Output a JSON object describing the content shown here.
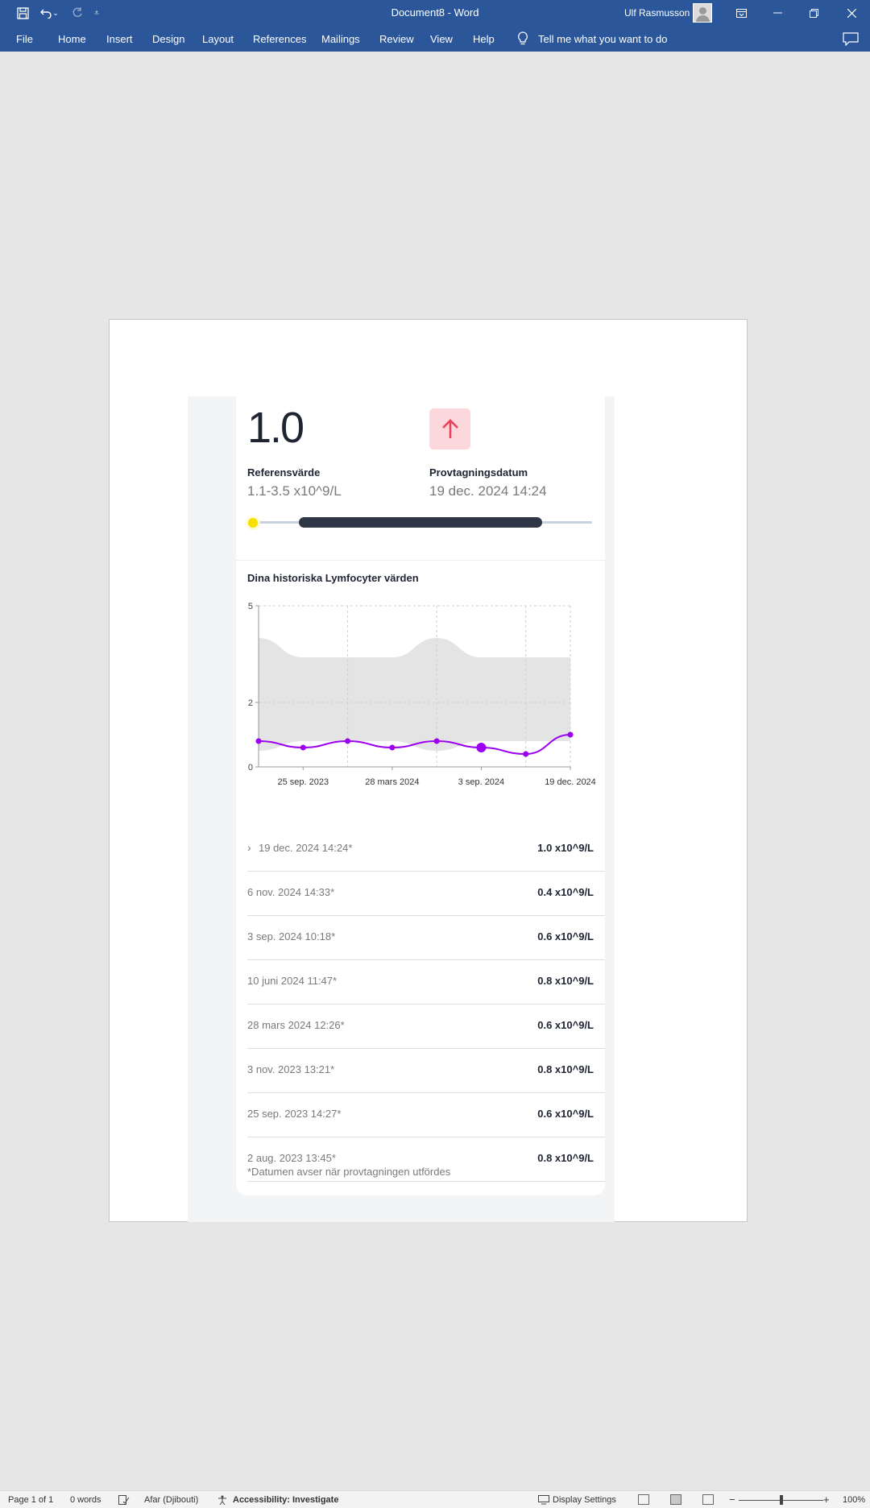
{
  "window": {
    "title": "Document8  -  Word",
    "user": "Ulf Rasmusson"
  },
  "ribbon": {
    "tabs": [
      "File",
      "Home",
      "Insert",
      "Design",
      "Layout",
      "References",
      "Mailings",
      "Review",
      "View",
      "Help"
    ],
    "tell_me": "Tell me what you want to do"
  },
  "result": {
    "value": "1.0",
    "reference_label": "Referensvärde",
    "reference_value": "1.1-3.5 x10^9/L",
    "date_label": "Provtagningsdatum",
    "date_value": "19 dec. 2024 14:24",
    "status": "arrow-up-icon",
    "range": {
      "min": 1.1,
      "max": 3.5,
      "value": 1.0
    }
  },
  "history": {
    "title": "Dina historiska Lymfocyter värden",
    "rows": [
      {
        "date": "19 dec. 2024 14:24*",
        "value": "1.0 x10^9/L"
      },
      {
        "date": "6 nov. 2024 14:33*",
        "value": "0.4 x10^9/L"
      },
      {
        "date": "3 sep. 2024 10:18*",
        "value": "0.6 x10^9/L"
      },
      {
        "date": "10 juni 2024 11:47*",
        "value": "0.8 x10^9/L"
      },
      {
        "date": "28 mars 2024 12:26*",
        "value": "0.6 x10^9/L"
      },
      {
        "date": "3 nov. 2023 13:21*",
        "value": "0.8 x10^9/L"
      },
      {
        "date": "25 sep. 2023 14:27*",
        "value": "0.6 x10^9/L"
      },
      {
        "date": "2 aug. 2023 13:45*",
        "value": "0.8 x10^9/L"
      }
    ],
    "footnote": "*Datumen avser när provtagningen utfördes"
  },
  "chart_data": {
    "type": "line",
    "title": "Dina historiska Lymfocyter värden",
    "x_tick_labels": [
      "25 sep. 2023",
      "28 mars 2024",
      "3 sep. 2024",
      "19 dec. 2024"
    ],
    "y_ticks": [
      0,
      2,
      5
    ],
    "ylim": [
      0,
      5
    ],
    "series": [
      {
        "x": [
          "2 aug. 2023",
          "25 sep. 2023",
          "3 nov. 2023",
          "28 mars 2024",
          "10 juni 2024",
          "3 sep. 2024",
          "6 nov. 2024",
          "19 dec. 2024"
        ],
        "values": [
          0.8,
          0.6,
          0.8,
          0.6,
          0.8,
          0.6,
          0.4,
          1.0
        ],
        "color": "#9b00f0"
      }
    ],
    "reference_band": {
      "lower": [
        0.5,
        0.8,
        0.8,
        0.8,
        0.5,
        0.8,
        0.8,
        0.8
      ],
      "upper": [
        4.0,
        3.4,
        3.4,
        3.4,
        4.0,
        3.4,
        3.4,
        3.4
      ],
      "color": "#e4e4e4"
    },
    "highlight_index": 5,
    "grid": true
  },
  "statusbar": {
    "page": "Page 1 of 1",
    "words": "0 words",
    "language": "Afar (Djibouti)",
    "accessibility": "Accessibility: Investigate",
    "display_settings": "Display Settings",
    "zoom": "100%"
  },
  "colors": {
    "ribbon": "#2b579a",
    "accent_line": "#9b00f0",
    "range_bar": "#2f3646",
    "indicator": "#f6e000",
    "alert_bg": "#fcd7dc",
    "alert_arrow": "#e8425c"
  }
}
